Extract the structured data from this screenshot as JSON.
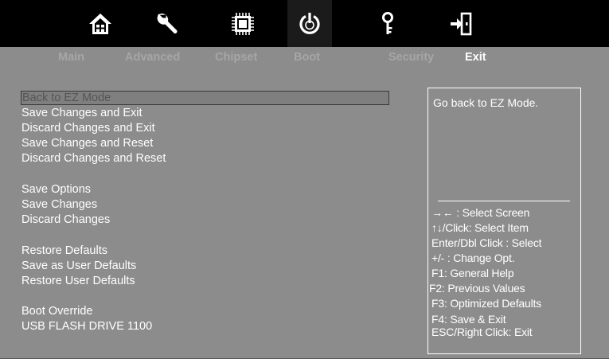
{
  "nav": {
    "icons": [
      {
        "name": "home-icon",
        "tab": "Main"
      },
      {
        "name": "wrench-icon",
        "tab": "Advanced"
      },
      {
        "name": "chip-icon",
        "tab": "Chipset"
      },
      {
        "name": "power-icon",
        "tab": "Boot"
      },
      {
        "name": "key-icon",
        "tab": "Security"
      },
      {
        "name": "exit-icon",
        "tab": "Exit"
      }
    ],
    "tabs": [
      "Main",
      "Advanced",
      "Chipset",
      "Boot",
      "Security",
      "Exit"
    ],
    "active_tab": "Exit"
  },
  "options": {
    "back_to_ez": "Back to EZ Mode",
    "save_exit": "Save Changes and Exit",
    "discard_exit": "Discard Changes and Exit",
    "save_reset": "Save Changes and Reset",
    "discard_reset": "Discard Changes and Reset",
    "save_options": "Save Options",
    "save_changes": "Save Changes",
    "discard_changes": "Discard Changes",
    "restore_defaults": "Restore Defaults",
    "save_user_defaults": "Save as User Defaults",
    "restore_user_defaults": "Restore User Defaults",
    "boot_override": "Boot Override",
    "usb_drive": "USB FLASH DRIVE 1100"
  },
  "help": {
    "description": "Go back to EZ Mode.",
    "keys": [
      "→←  : Select Screen",
      "↑↓/Click: Select Item",
      "Enter/Dbl Click : Select",
      "+/- : Change Opt.",
      "F1: General Help",
      "F2: Previous Values",
      "F3: Optimized Defaults",
      "F4: Save & Exit",
      "ESC/Right Click: Exit"
    ]
  },
  "colors": {
    "background": "#8c8c8c",
    "top_bar": "#000000",
    "active_text": "#ffffff",
    "inactive_tab": "#a6a6a6"
  }
}
